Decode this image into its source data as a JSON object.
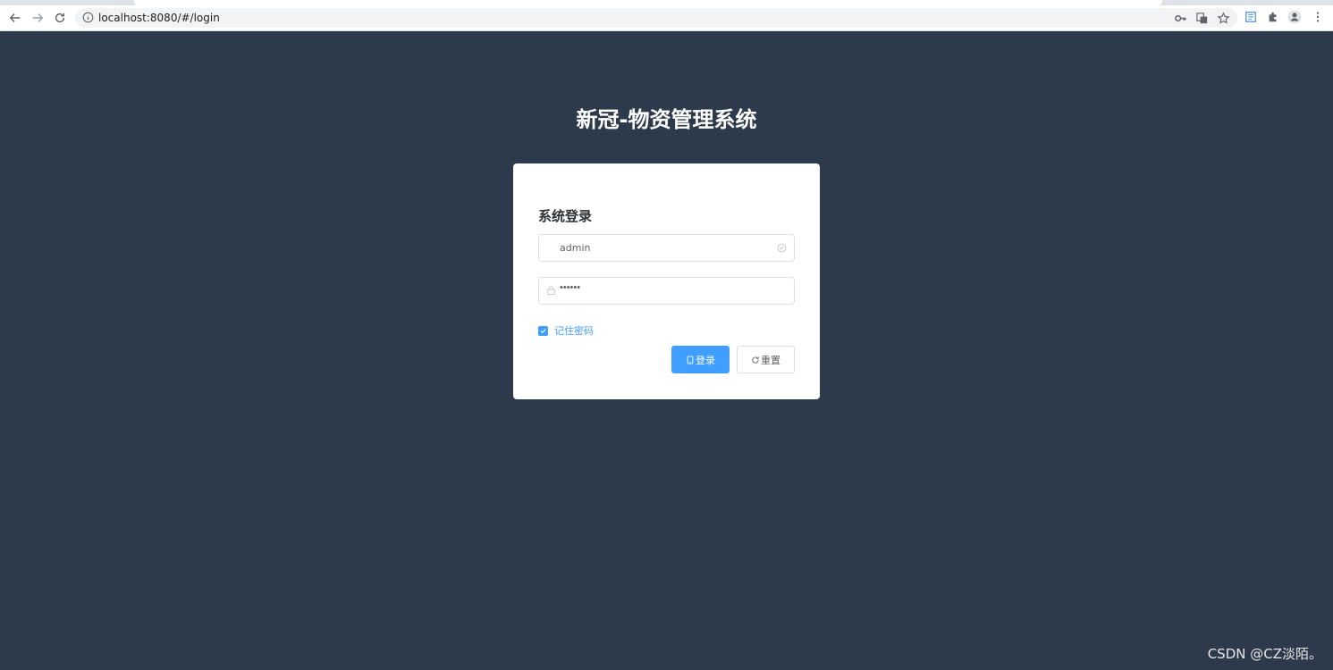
{
  "browser": {
    "url": "localhost:8080/#/login",
    "icons": [
      "back-icon",
      "forward-icon",
      "reload-icon",
      "info-icon",
      "key-icon",
      "translate-icon",
      "star-icon",
      "bookmark-manager-icon",
      "extensions-icon",
      "profile-icon",
      "menu-icon"
    ]
  },
  "page": {
    "title": "新冠-物资管理系统"
  },
  "login": {
    "heading": "系统登录",
    "username_value": "admin",
    "password_value": "••••••",
    "remember_label": "记住密码",
    "remember_checked": true,
    "login_button": "登录",
    "reset_button": "重置"
  },
  "watermark": "CSDN @CZ淡陌。",
  "colors": {
    "background": "#2d3a4b",
    "primary": "#409eff",
    "card": "#ffffff"
  }
}
